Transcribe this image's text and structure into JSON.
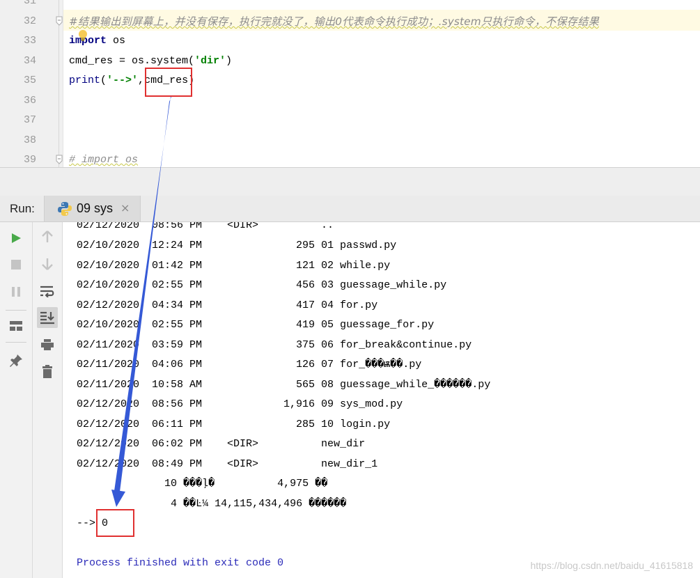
{
  "editor": {
    "line_numbers": [
      "31",
      "32",
      "33",
      "34",
      "35",
      "36",
      "37",
      "38",
      "39"
    ],
    "lines": {
      "l32_comment": "#结果输出到屏幕上，并没有保存，执行完就没了，输出0代表命令执行成功；.system只执行命令，不保存结果",
      "l33_kw": "import",
      "l33_rest": " os",
      "l34_pre": "cmd_res = os.system(",
      "l34_str": "'dir'",
      "l34_post": ")",
      "l35_fn": "print",
      "l35_open": "(",
      "l35_str": "'-->'",
      "l35_comma": ",",
      "l35_var": "cmd_res",
      "l35_close": ")",
      "l39_comment": "# import os"
    }
  },
  "run": {
    "label": "Run:",
    "tab_title": "09 sys",
    "close_glyph": "×"
  },
  "toolbar": {
    "icons": [
      "run-icon",
      "stop-icon",
      "pause-icon",
      "layout-icon",
      "pin-icon",
      "up-arrow-icon",
      "down-arrow-icon",
      "soft-wrap-icon",
      "scroll-to-end-icon",
      "print-icon",
      "trash-icon"
    ]
  },
  "console": {
    "lines": [
      "02/12/2020  08:56 PM    <DIR>          ..",
      "02/10/2020  12:24 PM               295 01 passwd.py",
      "02/10/2020  01:42 PM               121 02 while.py",
      "02/10/2020  02:55 PM               456 03 guessage_while.py",
      "02/12/2020  04:34 PM               417 04 for.py",
      "02/10/2020  02:55 PM               419 05 guessage_for.py",
      "02/11/2020  03:59 PM               375 06 for_break&continue.py",
      "02/11/2020  04:06 PM               126 07 for_���ѭ��.py",
      "02/11/2020  10:58 AM               565 08 guessage_while_������.py",
      "02/12/2020  08:56 PM             1,916 09 sys_mod.py",
      "02/12/2020  06:11 PM               285 10 login.py",
      "02/12/2020  06:02 PM    <DIR>          new_dir",
      "02/12/2020  08:49 PM    <DIR>          new_dir_1",
      "              10 ���ļ�          4,975 ��",
      "               4 ��Ŀ¼ 14,115,434,496 ������"
    ],
    "result_prefix": "-->",
    "result_value": "0",
    "exit_message": "Process finished with exit code 0"
  },
  "watermark": "https://blog.csdn.net/baidu_41615818",
  "colors": {
    "annotation_red": "#e03030",
    "arrow_blue": "#3559d6"
  }
}
